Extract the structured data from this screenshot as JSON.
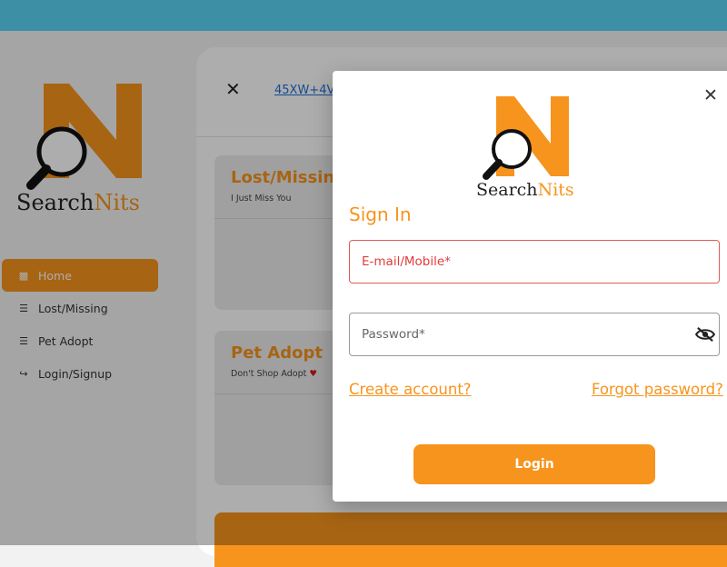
{
  "brand": {
    "name_a": "Search",
    "name_b": "Nits",
    "logo_letter": "N"
  },
  "sidebar": {
    "items": [
      {
        "label": "Home",
        "icon": "home-icon",
        "active": true
      },
      {
        "label": "Lost/Missing",
        "icon": "list-icon",
        "active": false
      },
      {
        "label": "Pet Adopt",
        "icon": "list-icon",
        "active": false
      },
      {
        "label": "Login/Signup",
        "icon": "login-icon",
        "active": false
      }
    ]
  },
  "main": {
    "close_symbol": "✕",
    "location_link": "45XW+4V",
    "cards": [
      {
        "title": "Lost/Missing",
        "subtitle": "I Just Miss You"
      },
      {
        "title": "Pet Adopt",
        "subtitle": "Don't Shop Adopt"
      }
    ]
  },
  "modal": {
    "close_symbol": "✕",
    "title": "Sign In",
    "email_label": "E-mail/Mobile*",
    "password_label": "Password*",
    "create_account": "Create account?",
    "forgot_password": "Forgot password?",
    "login_button": "Login"
  },
  "colors": {
    "topbar": "#5ad3f3",
    "accent": "#f7941d",
    "logo_n": "#f7941d",
    "error": "#e23b3b",
    "link_blue": "#1e6fd9"
  }
}
